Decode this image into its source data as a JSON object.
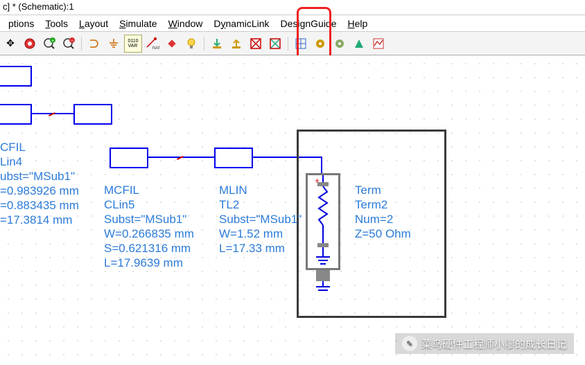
{
  "window": {
    "title": "c] * (Schematic):1"
  },
  "menu": {
    "options": "ptions",
    "tools": "Tools",
    "layout": "Layout",
    "simulate": "Simulate",
    "window": "Window",
    "dynamiclink": "DynamicLink",
    "designguide": "DesignGuide",
    "help": "Help"
  },
  "toolbar_icons": {
    "move": "✥",
    "globe": "◉",
    "zoomin": "⊕",
    "zoomout": "⊖",
    "gate": "⊃",
    "ground": "⏚",
    "var": "VAR",
    "name": "NAME",
    "ruler": "📐",
    "bulb": "💡",
    "dnarrow": "⬇",
    "uparrow": "⬆",
    "xred1": "✖",
    "xred2": "✖",
    "grid": "▦",
    "gear": "⚙",
    "gear2": "⚙",
    "tri": "▲",
    "chart": "📈"
  },
  "components": {
    "clin4": {
      "type": "CFIL",
      "name": "Lin4",
      "subst": "ubst=\"MSub1\"",
      "w": "=0.983926 mm",
      "s": "=0.883435 mm",
      "l": "=17.3814 mm"
    },
    "clin5": {
      "type": "MCFIL",
      "name": "CLin5",
      "subst": "Subst=\"MSub1\"",
      "w": "W=0.266835 mm",
      "s": "S=0.621316 mm",
      "l": "L=17.9639 mm"
    },
    "tl2": {
      "type": "MLIN",
      "name": "TL2",
      "subst": "Subst=\"MSub1\"",
      "w": "W=1.52 mm",
      "l": "L=17.33 mm"
    },
    "term2": {
      "type": "Term",
      "name": "Term2",
      "num": "Num=2",
      "z": "Z=50 Ohm"
    }
  },
  "watermark": {
    "text": "菜鸟硬件工程师小廖的成长日记"
  }
}
